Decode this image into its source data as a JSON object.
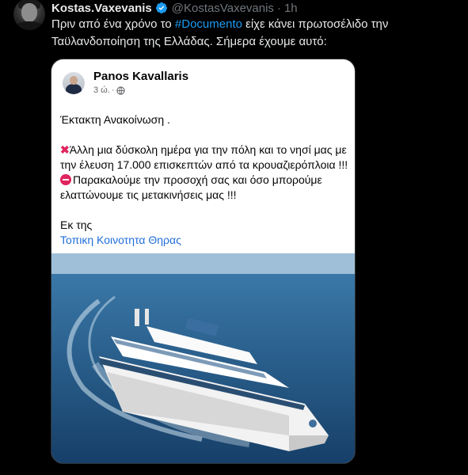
{
  "tweet": {
    "author_name": "Kostas.Vaxevanis",
    "handle": "@KostasVaxevanis",
    "separator": "·",
    "time": "1h",
    "text_line1_prefix": "Πριν από ένα χρόνο το ",
    "hashtag": "#Documento",
    "text_line1_suffix": " είχε κάνει πρωτοσέλιδο την",
    "text_line2": "Ταϋλανδοποίηση της Ελλάδας. Σήμερα έχουμε αυτό:"
  },
  "post": {
    "author_name": "Panos Kavallaris",
    "time": "3 ώ.",
    "separator": "·",
    "heading": "Έκτακτη Ανακοίνωση .",
    "line1": "Άλλη μια δύσκολη ημέρα για την πόλη και το νησί μας με την έλευση 17.000 επισκεπτών από τα κρουαζιερόπλοια !!!",
    "line2": "Παρακαλούμε την προσοχή σας και όσο μπορούμε ελαττώνουμε τις μετακινήσεις μας !!!",
    "from_label": "Εκ της",
    "page_link": "Τοπικη Κοινοτητα Θηρας"
  },
  "colors": {
    "background": "#000000",
    "text_primary": "#e7e9ea",
    "text_secondary": "#71767b",
    "accent": "#1d9bf0",
    "fb_link": "#216fdb"
  },
  "icons": [
    "verified-badge-icon",
    "globe-icon",
    "cross-mark-icon",
    "no-entry-icon"
  ]
}
